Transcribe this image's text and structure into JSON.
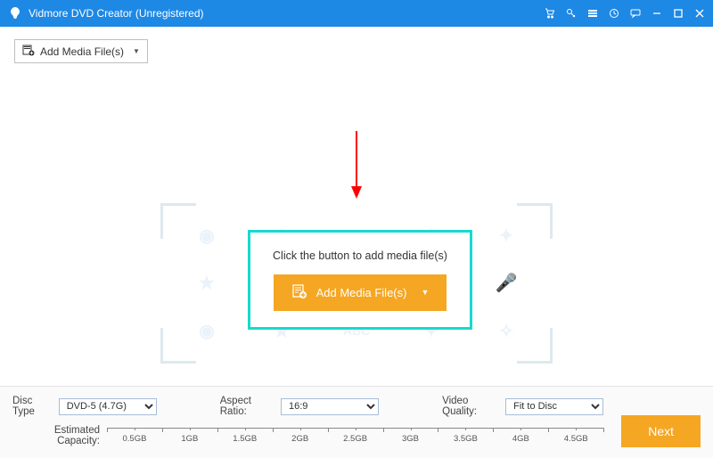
{
  "titlebar": {
    "app_name": "Vidmore DVD Creator (Unregistered)"
  },
  "toolbar": {
    "add_media_label": "Add Media File(s)"
  },
  "drop": {
    "hint": "Click the button to add media file(s)",
    "add_media_label": "Add Media File(s)"
  },
  "footer": {
    "disc_type_label": "Disc Type",
    "disc_type_value": "DVD-5 (4.7G)",
    "aspect_label": "Aspect Ratio:",
    "aspect_value": "16:9",
    "vq_label": "Video Quality:",
    "vq_value": "Fit to Disc",
    "capacity_label": "Estimated Capacity:",
    "ticks": [
      "0.5GB",
      "1GB",
      "1.5GB",
      "2GB",
      "2.5GB",
      "3GB",
      "3.5GB",
      "4GB",
      "4.5GB"
    ],
    "next_label": "Next"
  }
}
